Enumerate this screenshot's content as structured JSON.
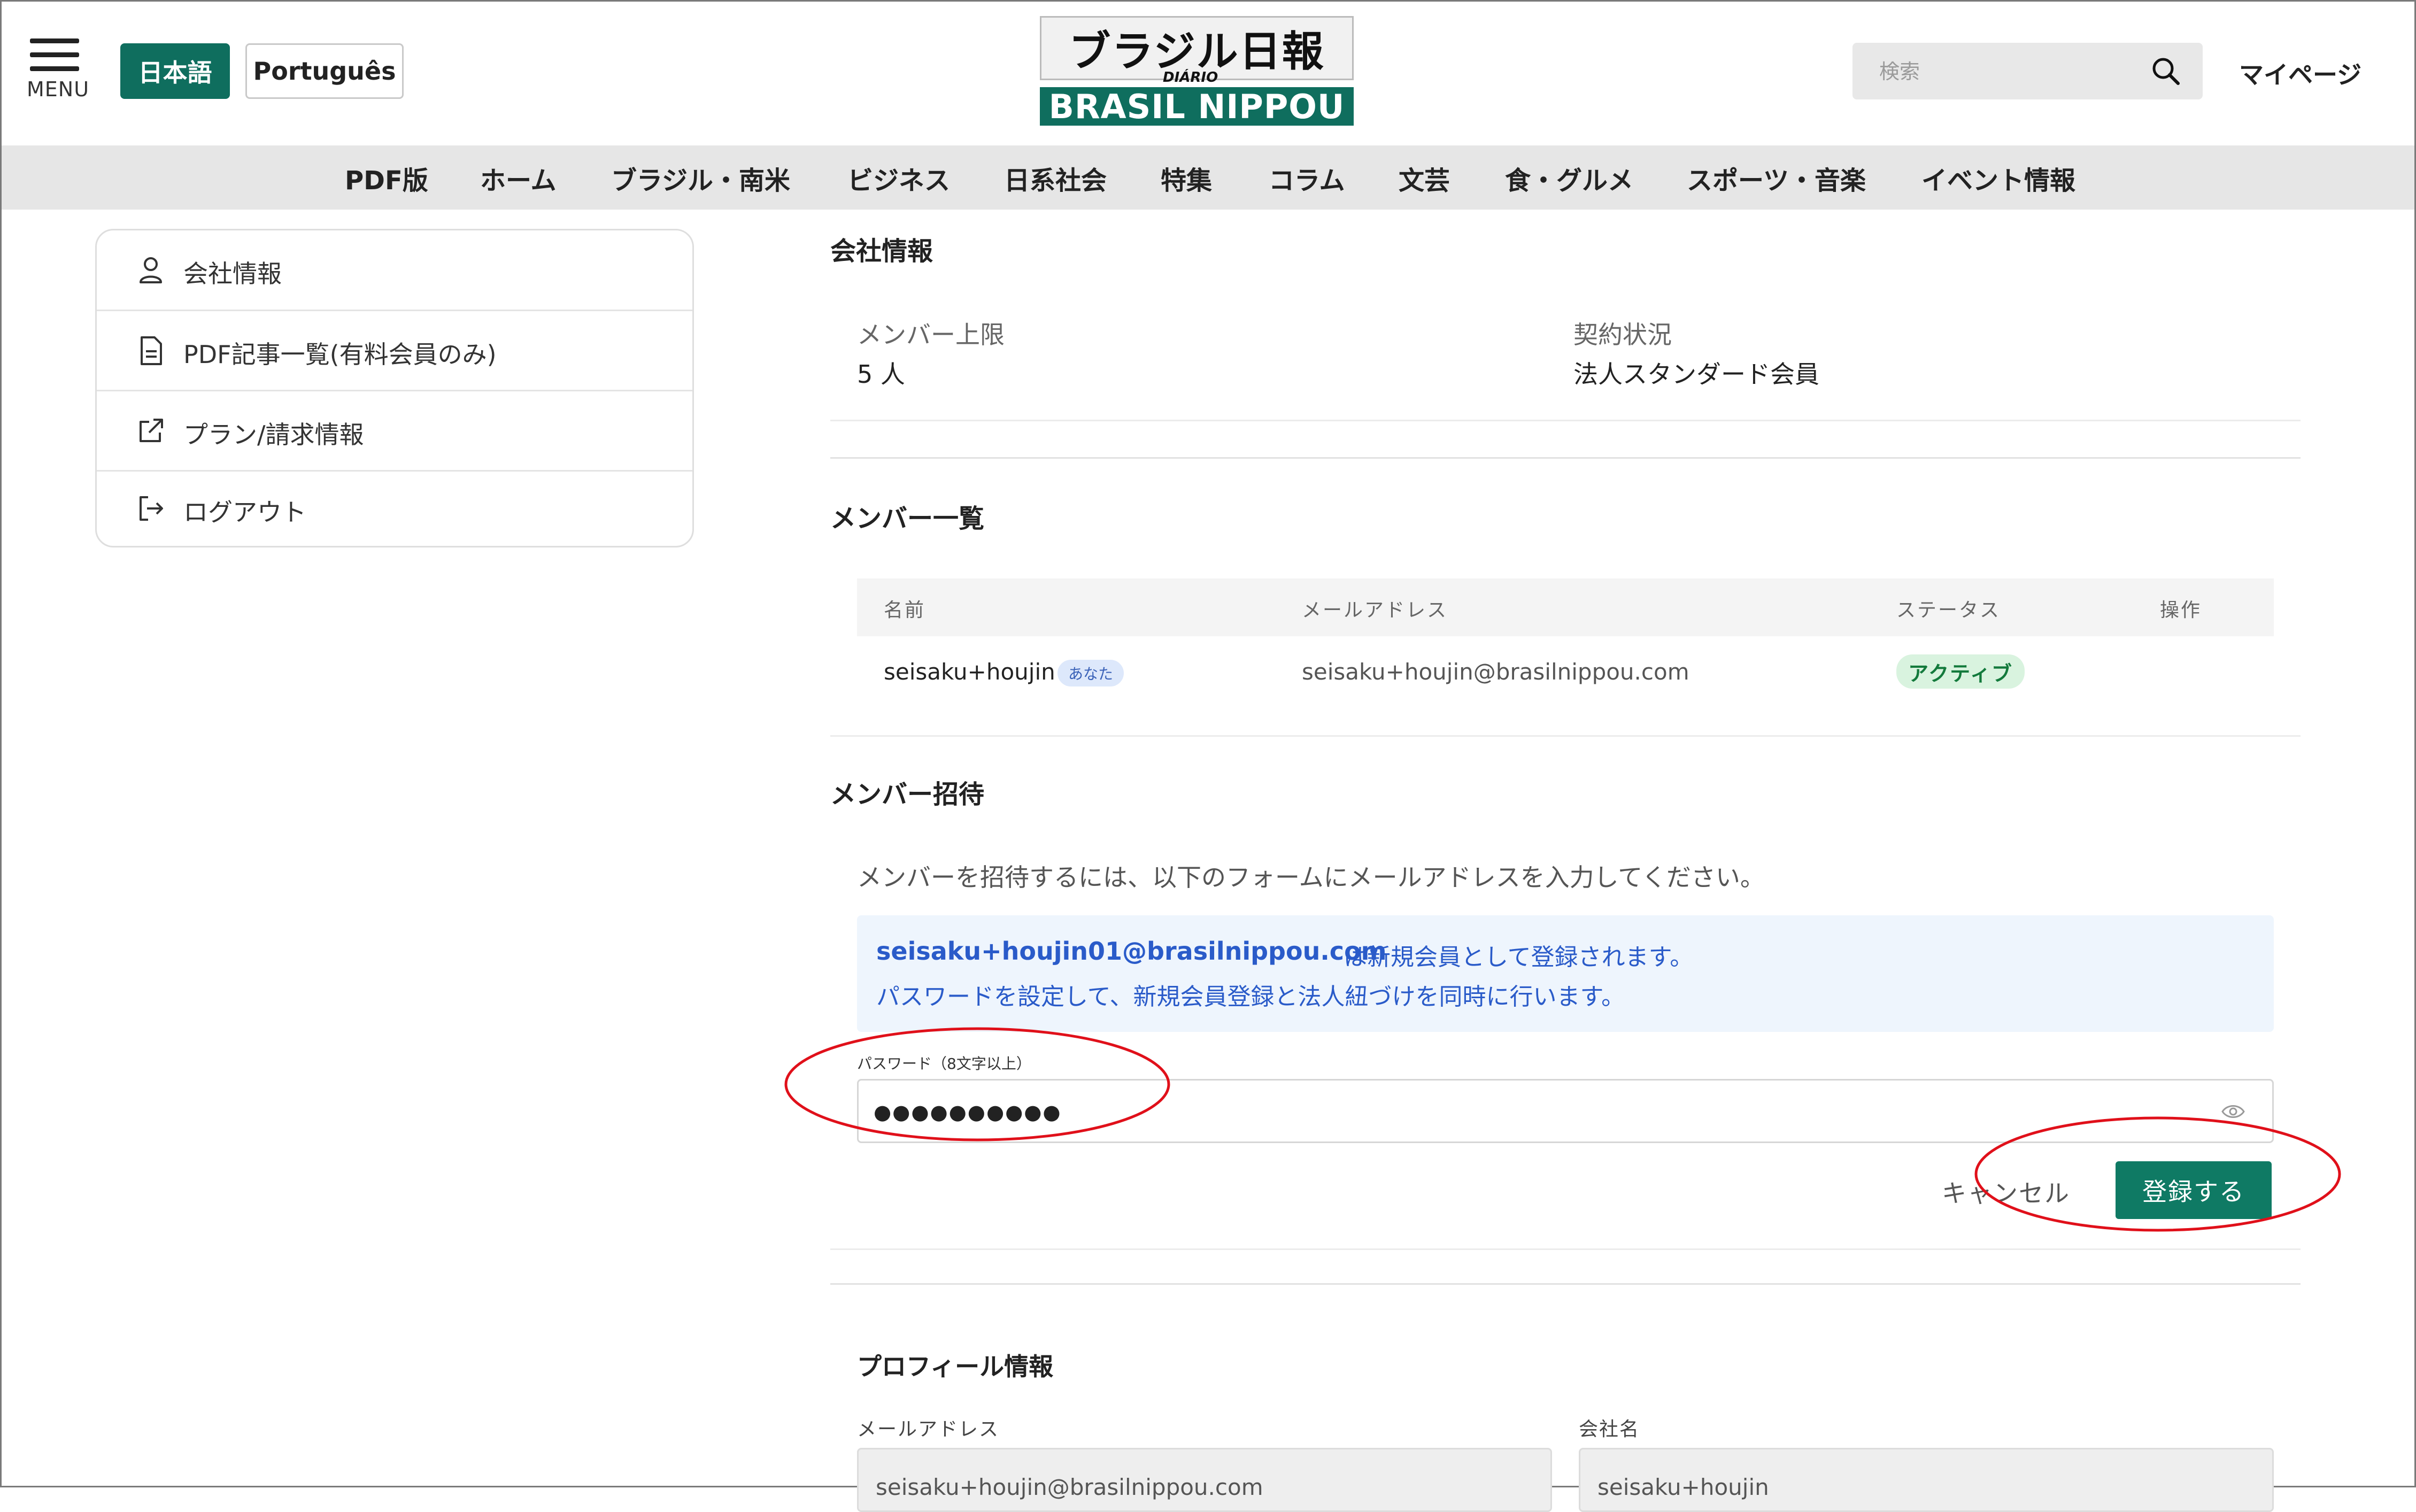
{
  "header": {
    "menu_label": "MENU",
    "lang_ja": "日本語",
    "lang_pt": "Português",
    "logo_top": "ブラジル日報",
    "logo_diario": "DIÁRIO",
    "logo_bottom": "BRASIL NIPPOU",
    "search_placeholder": "検索",
    "mypage": "マイページ"
  },
  "nav": [
    "PDF版",
    "ホーム",
    "ブラジル・南米",
    "ビジネス",
    "日系社会",
    "特集",
    "コラム",
    "文芸",
    "食・グルメ",
    "スポーツ・音楽",
    "イベント情報"
  ],
  "sidebar": {
    "items": [
      {
        "label": "会社情報",
        "icon": "user-icon"
      },
      {
        "label": "PDF記事一覧(有料会員のみ)",
        "icon": "document-icon"
      },
      {
        "label": "プラン/請求情報",
        "icon": "external-link-icon"
      },
      {
        "label": "ログアウト",
        "icon": "logout-icon"
      }
    ]
  },
  "company": {
    "heading": "会社情報",
    "member_limit_label": "メンバー上限",
    "member_limit_value": "5 人",
    "contract_label": "契約状況",
    "contract_value": "法人スタンダード会員"
  },
  "members": {
    "heading": "メンバー一覧",
    "columns": [
      "名前",
      "メールアドレス",
      "ステータス",
      "操作"
    ],
    "rows": [
      {
        "name": "seisaku+houjin",
        "badge": "あなた",
        "email": "seisaku+houjin@brasilnippou.com",
        "status": "アクティブ"
      }
    ]
  },
  "invite": {
    "heading": "メンバー招待",
    "description": "メンバーを招待するには、以下のフォームにメールアドレスを入力してください。",
    "notice_email": "seisaku+houjin01@brasilnippou.com",
    "notice_rest": "は新規会員として登録されます。",
    "notice_line2": "パスワードを設定して、新規会員登録と法人紐づけを同時に行います。",
    "password_label": "パスワード（8文字以上）",
    "password_value": "●●●●●●●●●●",
    "cancel_label": "キャンセル",
    "submit_label": "登録する"
  },
  "profile": {
    "heading": "プロフィール情報",
    "email_label": "メールアドレス",
    "email_value": "seisaku+houjin@brasilnippou.com",
    "company_label": "会社名",
    "company_value": "seisaku+houjin"
  },
  "colors": {
    "brand_green": "#0f6e5e",
    "notice_blue": "#2a5bc9",
    "annotation_red": "#e0101a"
  }
}
